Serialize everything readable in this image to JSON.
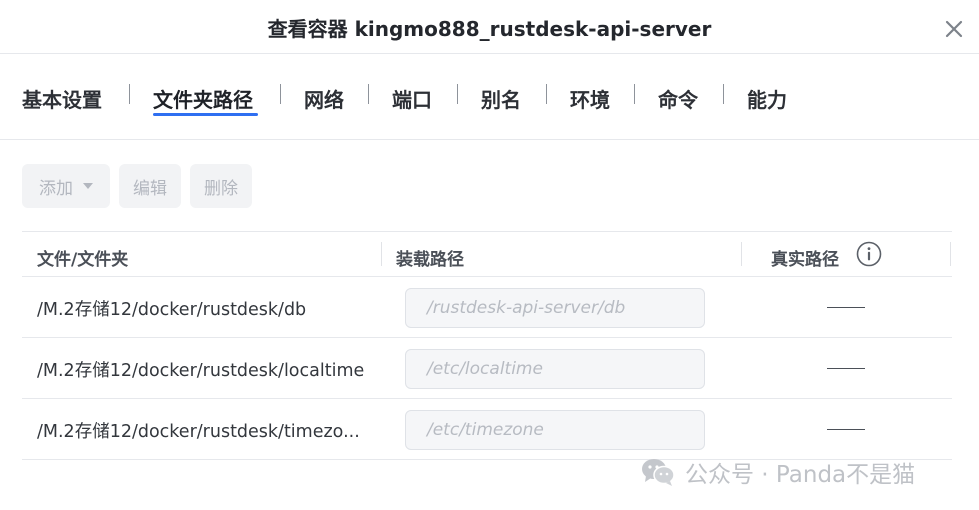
{
  "dialog": {
    "title": "查看容器 kingmo888_rustdesk-api-server"
  },
  "tabs": [
    {
      "label": "基本设置",
      "active": false
    },
    {
      "label": "文件夹路径",
      "active": true
    },
    {
      "label": "网络",
      "active": false
    },
    {
      "label": "端口",
      "active": false
    },
    {
      "label": "别名",
      "active": false
    },
    {
      "label": "环境",
      "active": false
    },
    {
      "label": "命令",
      "active": false
    },
    {
      "label": "能力",
      "active": false
    }
  ],
  "toolbar": {
    "add_label": "添加",
    "edit_label": "编辑",
    "delete_label": "删除"
  },
  "table": {
    "headers": {
      "file": "文件/文件夹",
      "mount": "装载路径",
      "real": "真实路径"
    },
    "rows": [
      {
        "file": "/M.2存储12/docker/rustdesk/db",
        "mount": "/rustdesk-api-server/db",
        "real": "——"
      },
      {
        "file": "/M.2存储12/docker/rustdesk/localtime",
        "mount": "/etc/localtime",
        "real": "——"
      },
      {
        "file": "/M.2存储12/docker/rustdesk/timezo...",
        "mount": "/etc/timezone",
        "real": "——"
      }
    ]
  },
  "watermark": {
    "text": "公众号 · Panda不是猫"
  },
  "colors": {
    "accent": "#2f6ff1",
    "disabled_text": "#b3b7bf",
    "divider": "#e6e8ec"
  },
  "icons": [
    "close-icon",
    "chevron-down-icon",
    "info-icon",
    "wechat-icon"
  ]
}
